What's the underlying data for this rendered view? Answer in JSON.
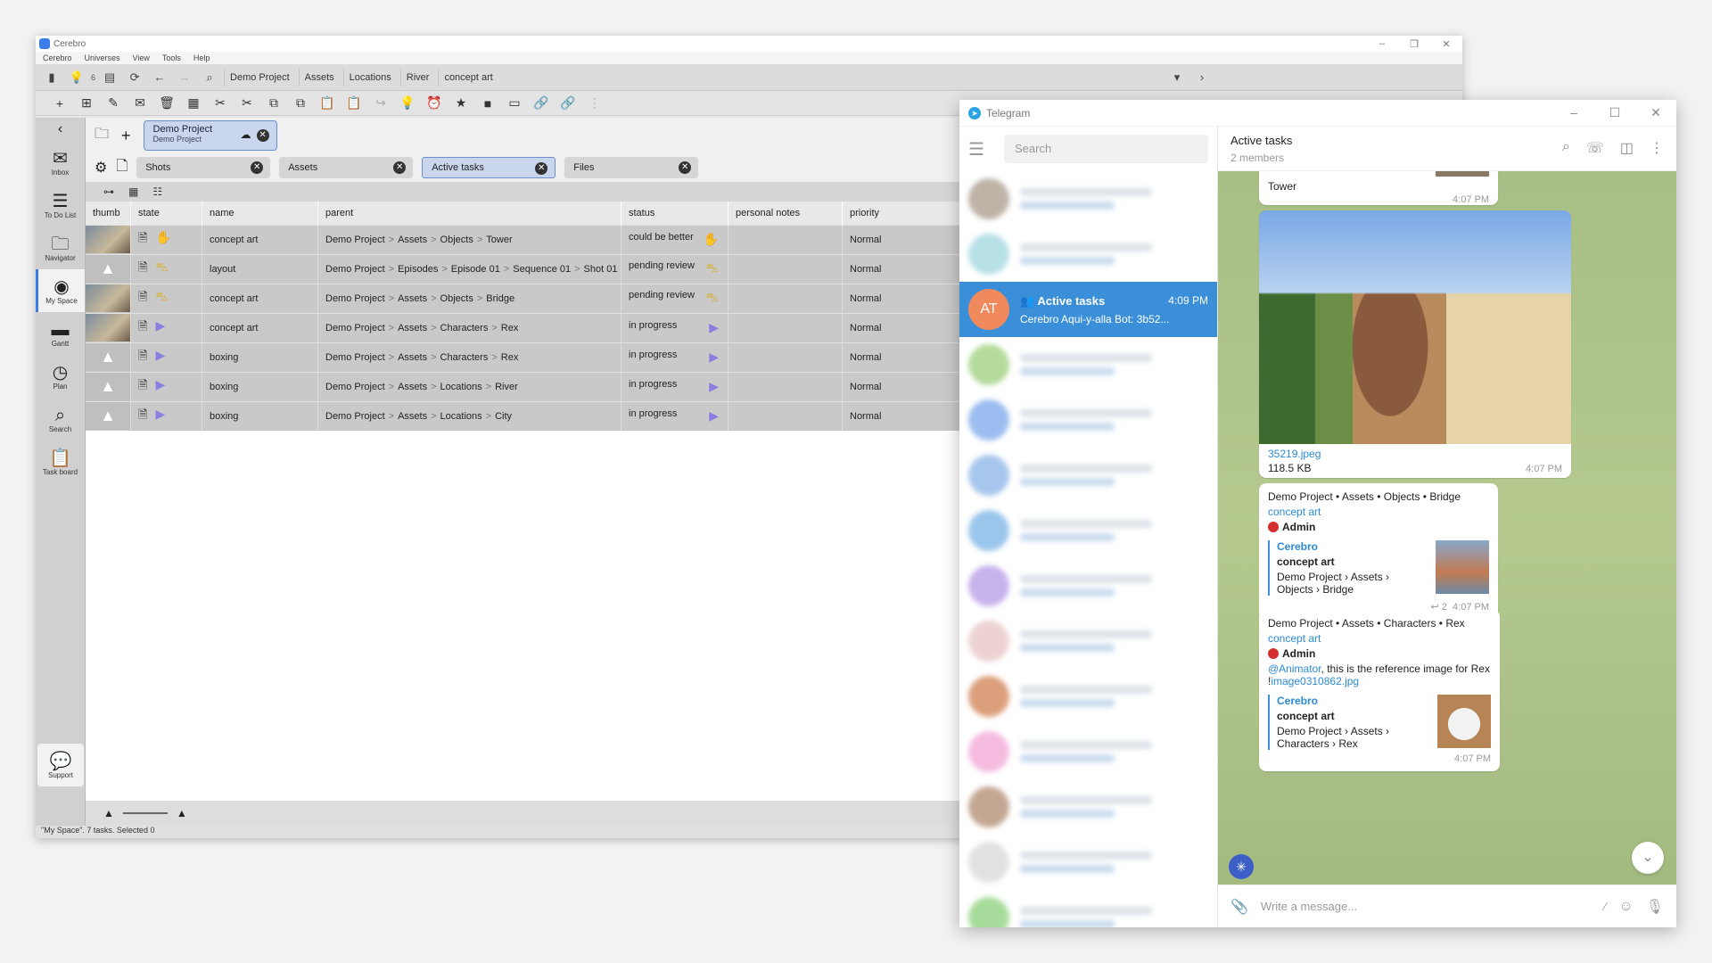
{
  "cerebro": {
    "title": "Cerebro",
    "menu": [
      "Cerebro",
      "Universes",
      "View",
      "Tools",
      "Help"
    ],
    "notif_count": "6",
    "breadcrumbs": [
      "Demo Project",
      "Assets",
      "Locations",
      "River",
      "concept art"
    ],
    "sidebar": [
      {
        "label": "Inbox",
        "icon": "mail-icon"
      },
      {
        "label": "To Do List",
        "icon": "list-icon"
      },
      {
        "label": "Navigator",
        "icon": "folder-icon"
      },
      {
        "label": "My Space",
        "icon": "globe-icon"
      },
      {
        "label": "Gantt",
        "icon": "gantt-icon"
      },
      {
        "label": "Plan",
        "icon": "clock-icon"
      },
      {
        "label": "Search",
        "icon": "search-icon"
      },
      {
        "label": "Task board",
        "icon": "clipboard-icon"
      }
    ],
    "support_label": "Support",
    "project_tab": {
      "title": "Demo Project",
      "subtitle": "Demo Project"
    },
    "filters": [
      {
        "label": "Shots",
        "active": false
      },
      {
        "label": "Assets",
        "active": false
      },
      {
        "label": "Active tasks",
        "active": true
      },
      {
        "label": "Files",
        "active": false
      }
    ],
    "table": {
      "headers": [
        "thumb",
        "state",
        "name",
        "parent",
        "status",
        "personal notes",
        "priority"
      ],
      "rows": [
        {
          "name": "concept art",
          "parent": [
            "Demo Project",
            "Assets",
            "Objects",
            "Tower"
          ],
          "status": "could be better",
          "priority": "Normal"
        },
        {
          "name": "layout",
          "parent": [
            "Demo Project",
            "Episodes",
            "Episode 01",
            "Sequence 01",
            "Shot 01"
          ],
          "status": "pending review",
          "priority": "Normal"
        },
        {
          "name": "concept art",
          "parent": [
            "Demo Project",
            "Assets",
            "Objects",
            "Bridge"
          ],
          "status": "pending review",
          "priority": "Normal"
        },
        {
          "name": "concept art",
          "parent": [
            "Demo Project",
            "Assets",
            "Characters",
            "Rex"
          ],
          "status": "in progress",
          "priority": "Normal"
        },
        {
          "name": "boxing",
          "parent": [
            "Demo Project",
            "Assets",
            "Characters",
            "Rex"
          ],
          "status": "in progress",
          "priority": "Normal"
        },
        {
          "name": "boxing",
          "parent": [
            "Demo Project",
            "Assets",
            "Locations",
            "River"
          ],
          "status": "in progress",
          "priority": "Normal"
        },
        {
          "name": "boxing",
          "parent": [
            "Demo Project",
            "Assets",
            "Locations",
            "City"
          ],
          "status": "in progress",
          "priority": "Normal"
        }
      ]
    },
    "statusbar": "\"My Space\". 7 tasks. Selected 0"
  },
  "telegram": {
    "title": "Telegram",
    "search_placeholder": "Search",
    "selected_chat": {
      "initials": "AT",
      "name": "Active tasks",
      "time": "4:09 PM",
      "preview": "Cerebro Aqui-y-alla Bot: 3b52..."
    },
    "header": {
      "name": "Active tasks",
      "members": "2 members"
    },
    "messages": {
      "m0": {
        "text": "Tower",
        "time": "4:07 PM"
      },
      "m1": {
        "file": "35219.jpeg",
        "size": "118.5 KB",
        "time": "4:07 PM"
      },
      "m2": {
        "path": "Demo Project • Assets • Objects • Bridge",
        "task": "concept art",
        "user": "Admin",
        "reply_from": "Cerebro",
        "reply_title": "concept art",
        "reply_path": "Demo Project › Assets › Objects › Bridge",
        "replies": "2",
        "time": "4:07 PM"
      },
      "m3": {
        "path": "Demo Project • Assets • Characters • Rex",
        "task": "concept art",
        "user": "Admin",
        "mention": "@Animator",
        "text": ", this is the reference image for Rex",
        "bang": "!",
        "image_link": "image0310862.jpg",
        "reply_from": "Cerebro",
        "reply_title": "concept art",
        "reply_path": "Demo Project › Assets › Characters › Rex",
        "time": "4:07 PM"
      }
    },
    "input_placeholder": "Write a message..."
  }
}
